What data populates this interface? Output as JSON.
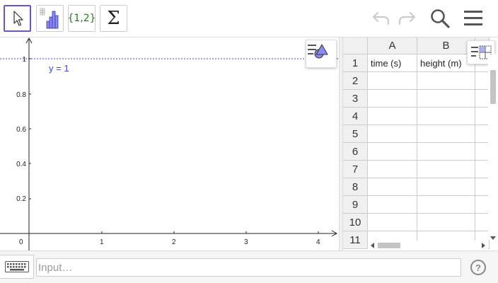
{
  "toolbar": {
    "tools": [
      {
        "name": "move-tool",
        "icon": "cursor-arrow-icon",
        "selected": true
      },
      {
        "name": "two-variable-regression-tool",
        "icon": "bar-histogram-icon",
        "selected": false
      },
      {
        "name": "create-list-tool",
        "label": "{1,2}",
        "selected": false
      },
      {
        "name": "sum-tool",
        "label": "Σ",
        "selected": false
      }
    ],
    "undo_icon": "undo-icon",
    "redo_icon": "redo-icon",
    "search_icon": "search-icon",
    "menu_icon": "hamburger-menu-icon"
  },
  "graphics": {
    "line_label": "y = 1",
    "line_color": "#4444dd",
    "x_ticks": [
      "0",
      "1",
      "2",
      "3",
      "4"
    ],
    "y_ticks": [
      "0.2",
      "0.4",
      "0.6",
      "0.8",
      "1"
    ],
    "style_bar_icon": "graphics-style-bar-icon"
  },
  "spreadsheet": {
    "columns": [
      "A",
      "B"
    ],
    "rows": [
      "1",
      "2",
      "3",
      "4",
      "5",
      "6",
      "7",
      "8",
      "9",
      "10",
      "11"
    ],
    "cells": [
      [
        "time (s)",
        "height (m)"
      ],
      [
        "",
        ""
      ],
      [
        "",
        ""
      ],
      [
        "",
        ""
      ],
      [
        "",
        ""
      ],
      [
        "",
        ""
      ],
      [
        "",
        ""
      ],
      [
        "",
        ""
      ],
      [
        "",
        ""
      ],
      [
        "",
        ""
      ],
      [
        "",
        ""
      ]
    ],
    "style_bar_icon": "spreadsheet-style-bar-icon"
  },
  "input_bar": {
    "placeholder": "Input…",
    "keyboard_icon": "keyboard-icon",
    "help_label": "?"
  }
}
